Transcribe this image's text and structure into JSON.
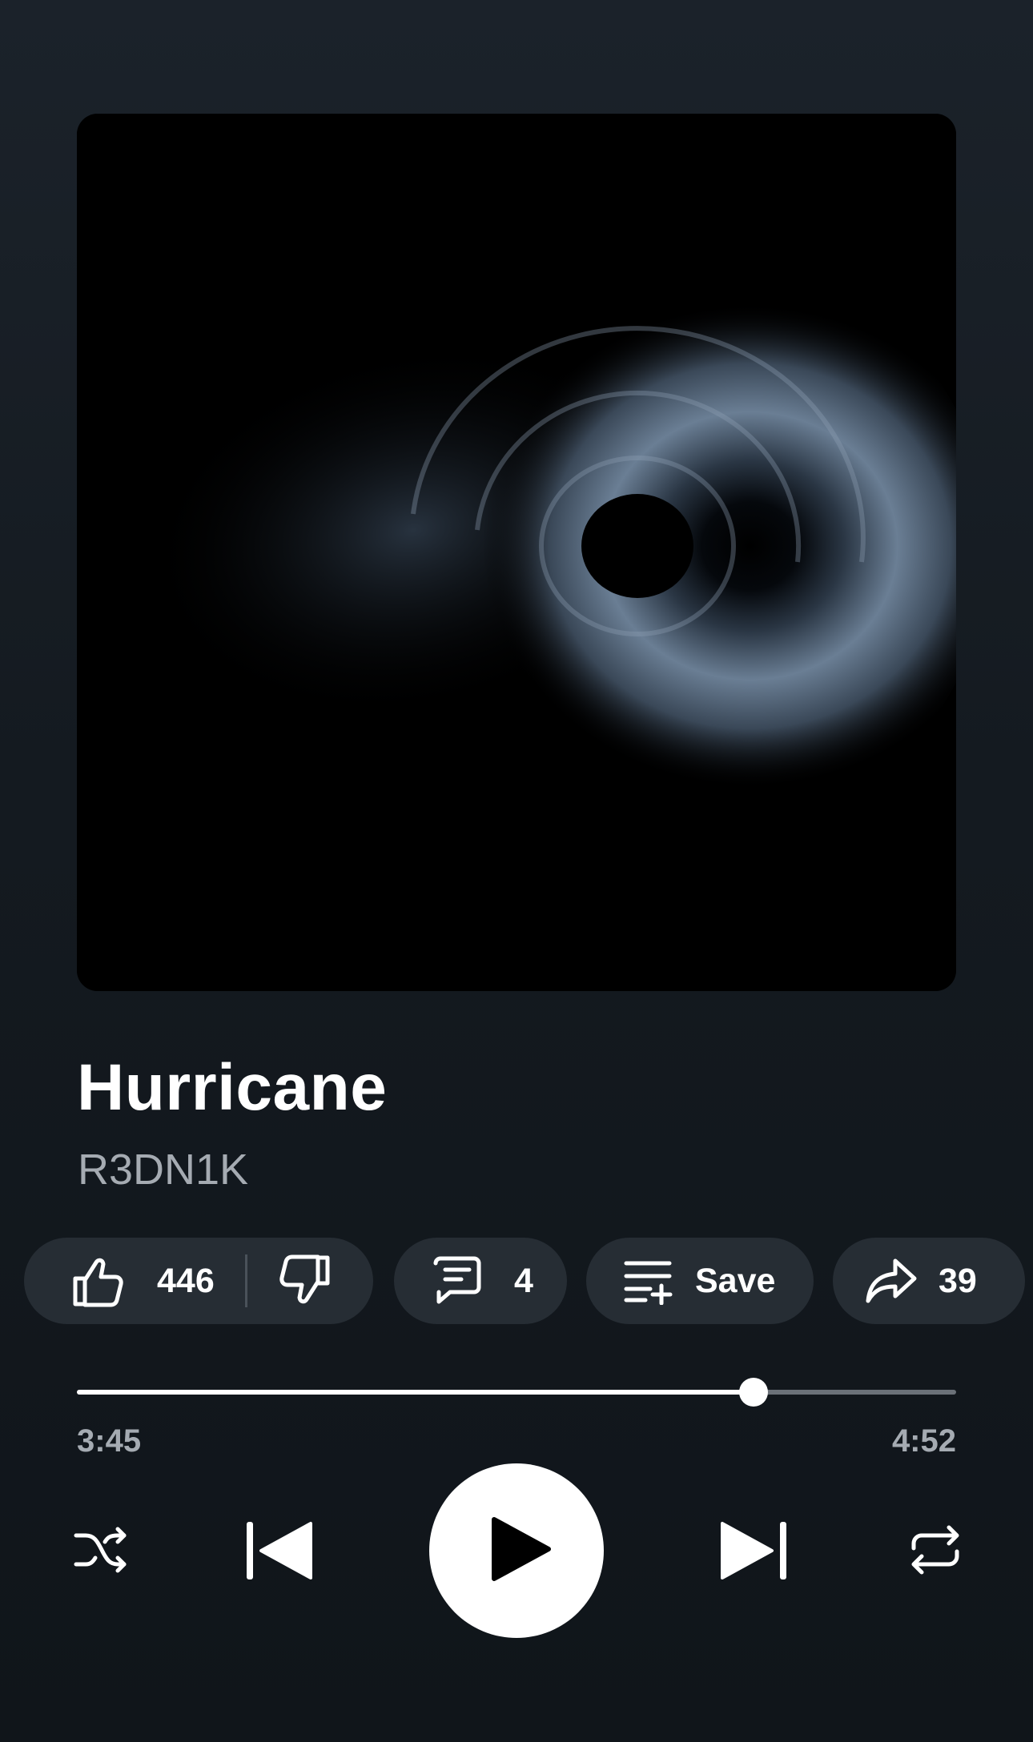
{
  "track": {
    "title": "Hurricane",
    "artist": "R3DN1K",
    "album_art_icon": "hurricane-swirl-artwork"
  },
  "actions": {
    "likes": "446",
    "comments": "4",
    "save_label": "Save",
    "shares": "39"
  },
  "playback": {
    "elapsed": "3:45",
    "total": "4:52",
    "progress_fraction": 0.77,
    "state": "paused"
  },
  "icons": {
    "like": "thumbs-up-icon",
    "dislike": "thumbs-down-icon",
    "comments": "comment-icon",
    "save": "playlist-add-icon",
    "share": "share-arrow-icon",
    "shuffle": "shuffle-icon",
    "previous": "skip-previous-icon",
    "play": "play-icon",
    "next": "skip-next-icon",
    "repeat": "repeat-icon"
  },
  "colors": {
    "background": "#161c22",
    "chip": "#262d34",
    "secondary_text": "#a5abb2",
    "accent": "#ffffff"
  }
}
